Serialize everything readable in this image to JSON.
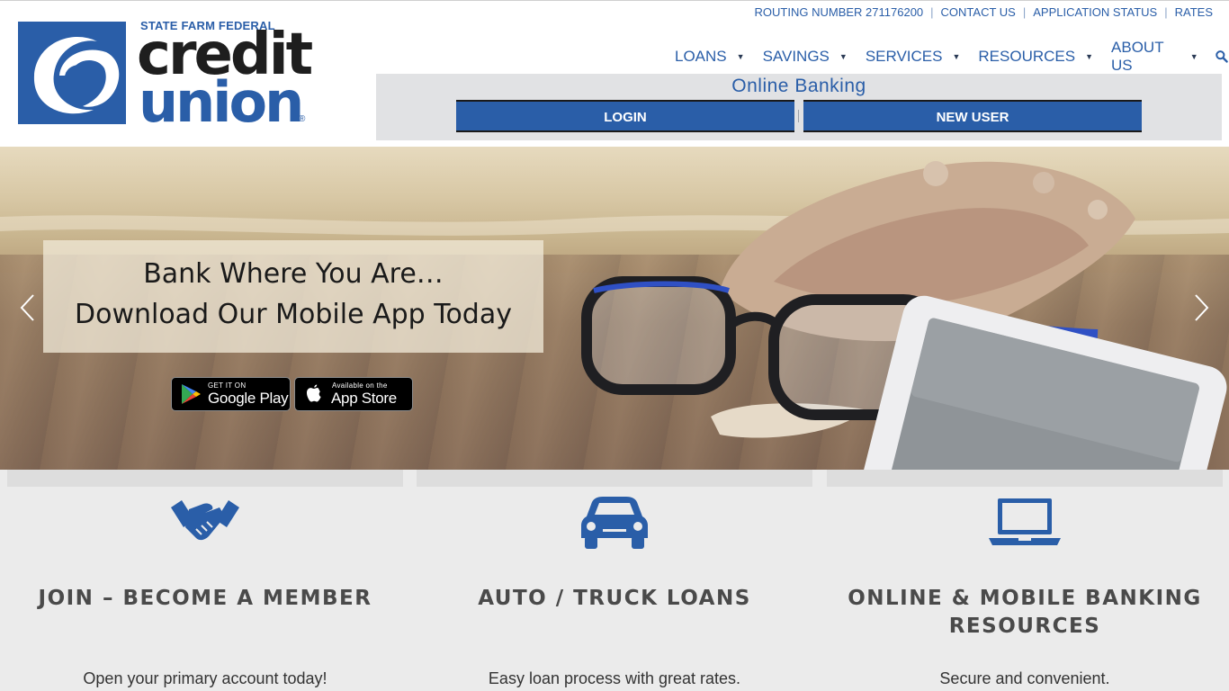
{
  "brand": {
    "eyebrow": "STATE FARM FEDERAL",
    "word1": "credit",
    "word2": "union",
    "reg": "®",
    "primary_color": "#2a5ea8",
    "dark_color": "#1e1e1e"
  },
  "utility_nav": {
    "items": [
      {
        "label": "ROUTING NUMBER 271176200"
      },
      {
        "label": "CONTACT US"
      },
      {
        "label": "APPLICATION STATUS"
      },
      {
        "label": "RATES"
      }
    ]
  },
  "main_nav": {
    "items": [
      {
        "label": "LOANS"
      },
      {
        "label": "SAVINGS"
      },
      {
        "label": "SERVICES"
      },
      {
        "label": "RESOURCES"
      },
      {
        "label": "ABOUT US"
      }
    ],
    "caret": "▼",
    "search_icon": "search-icon"
  },
  "online_banking": {
    "title": "Online Banking",
    "login_label": "LOGIN",
    "new_user_label": "NEW USER"
  },
  "hero": {
    "line1": "Bank Where You Are…",
    "line2": "Download Our Mobile App Today",
    "google_play": {
      "small": "GET IT ON",
      "big": "Google Play"
    },
    "app_store": {
      "small": "Available on the",
      "big": "App Store"
    },
    "prev_icon": "chevron-left-icon",
    "next_icon": "chevron-right-icon"
  },
  "features": [
    {
      "heading": "JOIN – BECOME A MEMBER",
      "description": "Open your primary account today!",
      "icon": "handshake-icon"
    },
    {
      "heading": "AUTO / TRUCK LOANS",
      "description": "Easy loan process with great rates.",
      "icon": "car-icon"
    },
    {
      "heading": "ONLINE & MOBILE BANKING RESOURCES",
      "description": "Secure and convenient.",
      "icon": "laptop-icon"
    }
  ]
}
